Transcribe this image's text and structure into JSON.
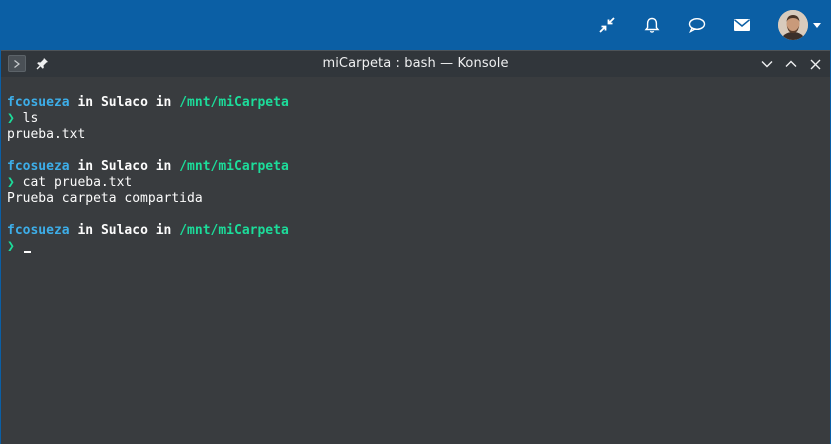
{
  "topbar": {
    "icons": [
      "shrink-arrows-icon",
      "bell-icon",
      "chat-bubble-icon",
      "envelope-icon"
    ],
    "accent": "#0b5fa5"
  },
  "window": {
    "title": "miCarpeta : bash — Konsole",
    "background": "#393c3f"
  },
  "terminal": {
    "blocks": [
      {
        "user": "fcosueza",
        "in1": "in",
        "host": "Sulaco",
        "in2": "in",
        "path": "/mnt/miCarpeta",
        "prompt": "❯",
        "command": "ls",
        "output": "prueba.txt"
      },
      {
        "user": "fcosueza",
        "in1": "in",
        "host": "Sulaco",
        "in2": "in",
        "path": "/mnt/miCarpeta",
        "prompt": "❯",
        "command": "cat prueba.txt",
        "output": "Prueba carpeta compartida"
      },
      {
        "user": "fcosueza",
        "in1": "in",
        "host": "Sulaco",
        "in2": "in",
        "path": "/mnt/miCarpeta",
        "prompt": "❯",
        "command": ""
      }
    ],
    "colors": {
      "user": "#3daee9",
      "path": "#1cdc9a",
      "text": "#fcfcfc"
    }
  }
}
